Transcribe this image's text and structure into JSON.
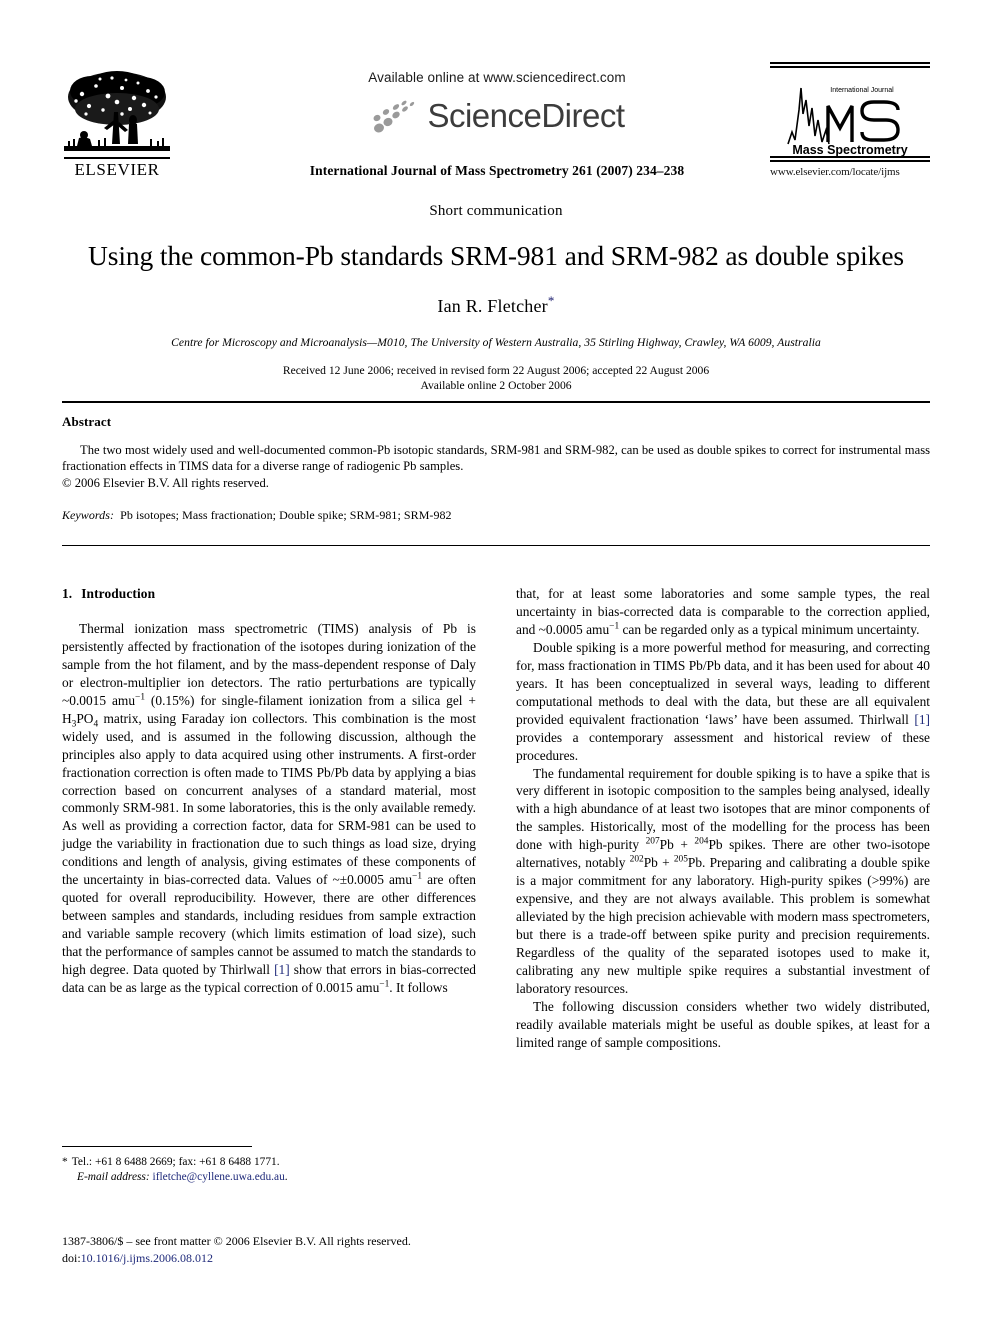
{
  "header": {
    "sciencedirect": {
      "available_text": "Available online at www.sciencedirect.com",
      "wordmark": "ScienceDirect"
    },
    "elsevier": {
      "wordmark": "ELSEVIER"
    },
    "journal_logo": {
      "small_top_text": "International Journal",
      "monogram": "MS",
      "caption": "Mass Spectrometry"
    },
    "journal_reference": "International Journal of Mass Spectrometry 261 (2007) 234–238",
    "journal_url": "www.elsevier.com/locate/ijms"
  },
  "title_block": {
    "article_type": "Short communication",
    "title": "Using the common-Pb standards SRM-981 and SRM-982 as double spikes",
    "author": "Ian R. Fletcher",
    "author_footnote_marker": "*",
    "affiliation": "Centre for Microscopy and Microanalysis—M010, The University of Western Australia, 35 Stirling Highway, Crawley, WA 6009, Australia",
    "received_line": "Received 12 June 2006; received in revised form 22 August 2006; accepted 22 August 2006",
    "available_line": "Available online 2 October 2006"
  },
  "abstract": {
    "heading": "Abstract",
    "text": "The two most widely used and well-documented common-Pb isotopic standards, SRM-981 and SRM-982, can be used as double spikes to correct for instrumental mass fractionation effects in TIMS data for a diverse range of radiogenic Pb samples.",
    "copyright": "© 2006 Elsevier B.V. All rights reserved.",
    "keywords_label": "Keywords:",
    "keywords": "Pb isotopes; Mass fractionation; Double spike; SRM-981; SRM-982"
  },
  "body": {
    "section_number": "1.",
    "section_title": "Introduction",
    "left_paragraph_1_a": "Thermal ionization mass spectrometric (TIMS) analysis of Pb is persistently affected by fractionation of the isotopes during ionization of the sample from the hot filament, and by the mass-dependent response of Daly or electron-multiplier ion detectors. The ratio perturbations are typically ~0.0015 amu",
    "left_paragraph_1_sup1": "−1",
    "left_paragraph_1_b": " (0.15%) for single-filament ionization from a silica gel + H",
    "left_paragraph_1_sub1": "3",
    "left_paragraph_1_c": "PO",
    "left_paragraph_1_sub2": "4",
    "left_paragraph_1_d": " matrix, using Faraday ion collectors. This combination is the most widely used, and is assumed in the following discussion, although the principles also apply to data acquired using other instruments. A first-order fractionation correction is often made to TIMS Pb/Pb data by applying a bias correction based on concurrent analyses of a standard material, most commonly SRM-981. In some laboratories, this is the only available remedy. As well as providing a correction factor, data for SRM-981 can be used to judge the variability in fractionation due to such things as load size, drying conditions and length of analysis, giving estimates of these components of the uncertainty in bias-corrected data. Values of ~±0.0005 amu",
    "left_paragraph_1_sup2": "−1",
    "left_paragraph_1_e": " are often quoted for overall reproducibility. However, there are other differences between samples and standards, including residues from sample extraction and variable sample recovery (which limits estimation of load size), such that the performance of samples cannot be assumed to match the standards to high degree. Data quoted by Thirlwall ",
    "left_ref_1": "[1]",
    "left_paragraph_1_f": " show that errors in bias-corrected data can be as large as the typical correction of 0.0015 amu",
    "left_paragraph_1_sup3": "−1",
    "left_paragraph_1_g": ". It follows",
    "right_paragraph_1_a": "that, for at least some laboratories and some sample types, the real uncertainty in bias-corrected data is comparable to the correction applied, and ~0.0005 amu",
    "right_paragraph_1_sup1": "−1",
    "right_paragraph_1_b": " can be regarded only as a typical minimum uncertainty.",
    "right_paragraph_2_a": "Double spiking is a more powerful method for measuring, and correcting for, mass fractionation in TIMS Pb/Pb data, and it has been used for about 40 years. It has been conceptualized in several ways, leading to different computational methods to deal with the data, but these are all equivalent provided equivalent fractionation ‘laws’ have been assumed. Thirlwall ",
    "right_ref_1": "[1]",
    "right_paragraph_2_b": " provides a contemporary assessment and historical review of these procedures.",
    "right_paragraph_3_a": "The fundamental requirement for double spiking is to have a spike that is very different in isotopic composition to the samples being analysed, ideally with a high abundance of at least two isotopes that are minor components of the samples. Historically, most of the modelling for the process has been done with high-purity ",
    "right_paragraph_3_sup1": "207",
    "right_paragraph_3_b": "Pb + ",
    "right_paragraph_3_sup2": "204",
    "right_paragraph_3_c": "Pb spikes. There are other two-isotope alternatives, notably ",
    "right_paragraph_3_sup3": "202",
    "right_paragraph_3_d": "Pb + ",
    "right_paragraph_3_sup4": "205",
    "right_paragraph_3_e": "Pb. Preparing and calibrating a double spike is a major commitment for any laboratory. High-purity spikes (>99%) are expensive, and they are not always available. This problem is somewhat alleviated by the high precision achievable with modern mass spectrometers, but there is a trade-off between spike purity and precision requirements. Regardless of the quality of the separated isotopes used to make it, calibrating any new multiple spike requires a substantial investment of laboratory resources.",
    "right_paragraph_4": "The following discussion considers whether two widely distributed, readily available materials might be useful as double spikes, at least for a limited range of sample compositions."
  },
  "footnote": {
    "marker": "*",
    "contact": "Tel.: +61 8 6488 2669; fax: +61 8 6488 1771.",
    "email_label": "E-mail address:",
    "email": "ifletche@cyllene.uwa.edu.au",
    "issn_line": "1387-3806/$ – see front matter © 2006 Elsevier B.V. All rights reserved.",
    "doi_label": "doi:",
    "doi": "10.1016/j.ijms.2006.08.012"
  },
  "colors": {
    "link": "#1f2a7a",
    "sciencedirect_gray": "#3c3c3c"
  }
}
